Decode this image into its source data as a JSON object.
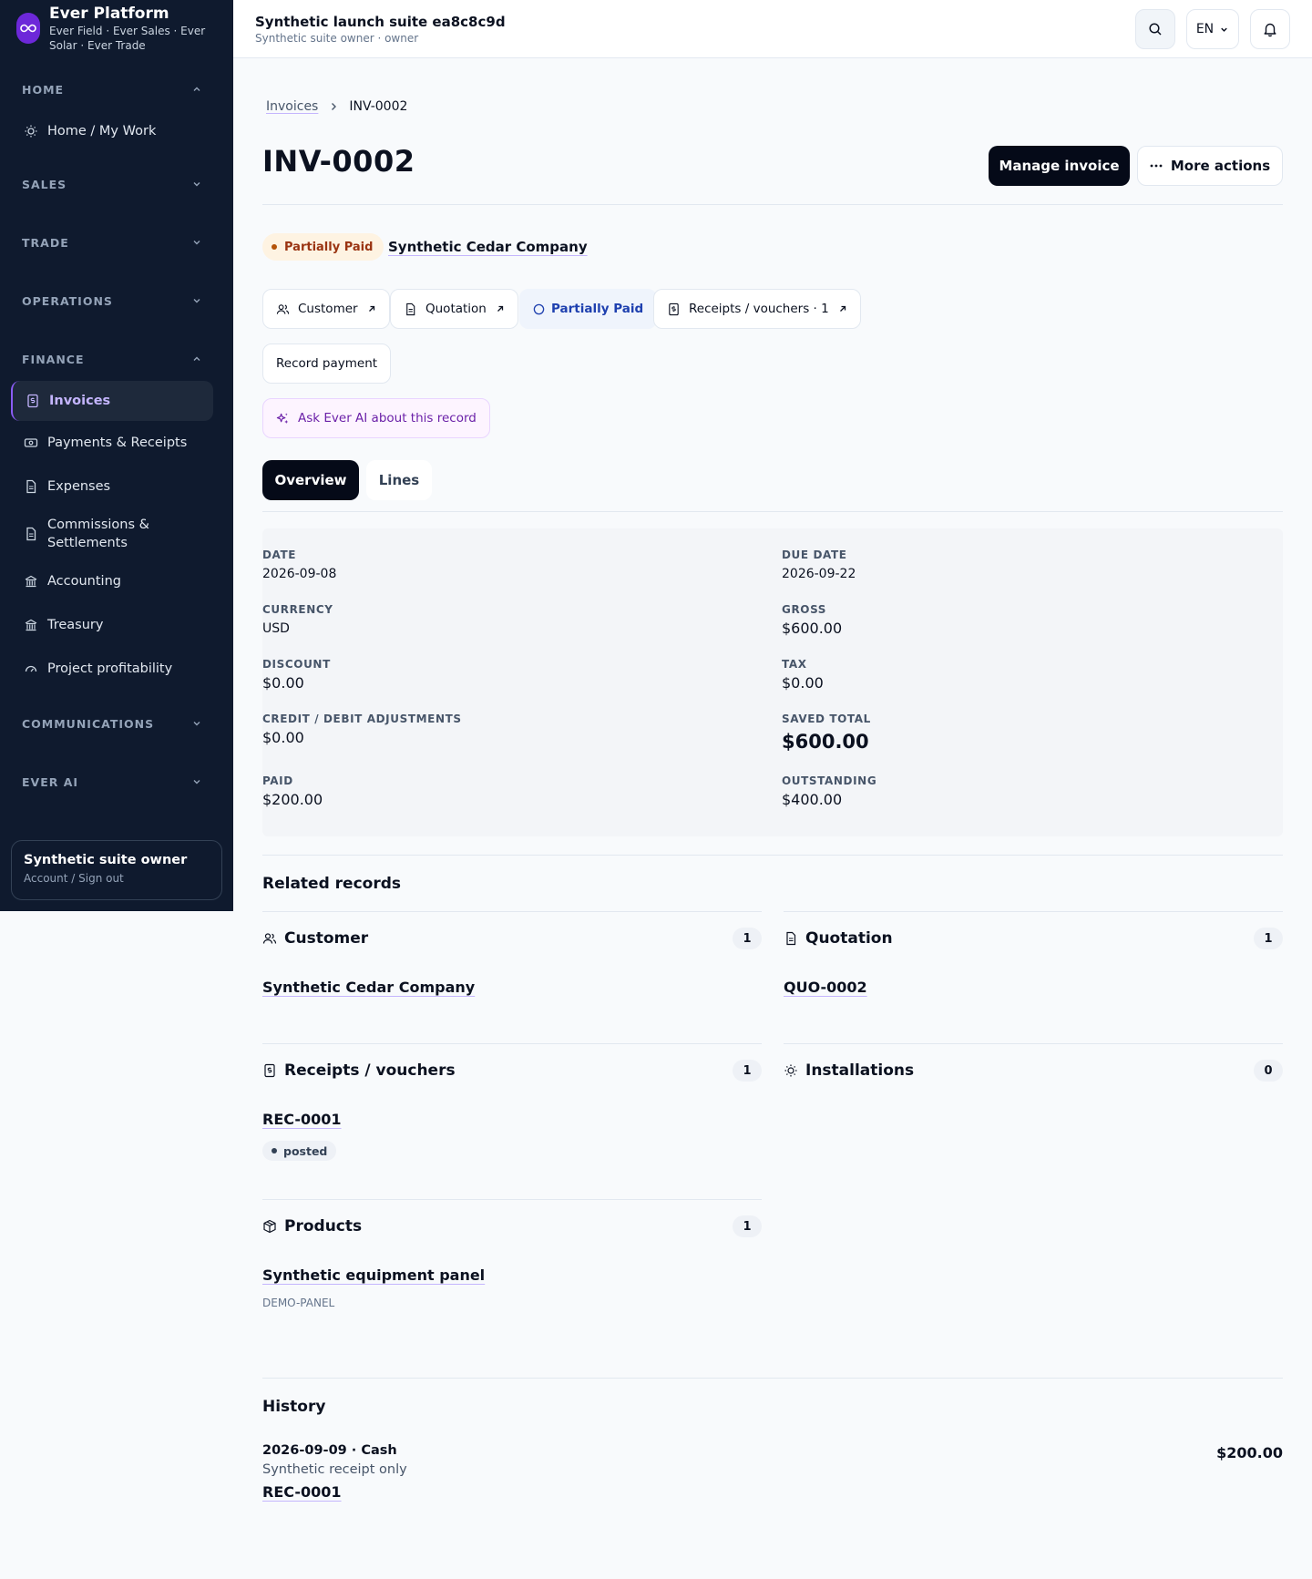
{
  "brand": {
    "name": "Ever Platform",
    "subtitle": "Ever Field · Ever Sales · Ever Solar · Ever Trade"
  },
  "sidebar": {
    "groups": {
      "home": "HOME",
      "sales": "SALES",
      "trade": "TRADE",
      "operations": "OPERATIONS",
      "finance": "FINANCE",
      "communications": "COMMUNICATIONS",
      "ever_ai": "EVER AI"
    },
    "home_item": "Home / My Work",
    "finance_items": [
      {
        "label": "Invoices",
        "icon": "receipt-icon"
      },
      {
        "label": "Payments & Receipts",
        "icon": "banknote-icon"
      },
      {
        "label": "Expenses",
        "icon": "document-icon"
      },
      {
        "label": "Commissions & Settlements",
        "icon": "document-icon"
      },
      {
        "label": "Accounting",
        "icon": "bank-icon"
      },
      {
        "label": "Treasury",
        "icon": "bank-icon"
      },
      {
        "label": "Project profitability",
        "icon": "gauge-icon"
      }
    ],
    "account": {
      "name": "Synthetic suite owner",
      "link": "Account / Sign out"
    }
  },
  "topbar": {
    "title": "Synthetic launch suite ea8c8c9d",
    "subtitle": "Synthetic suite owner · owner",
    "lang": "EN"
  },
  "breadcrumb": {
    "parent": "Invoices",
    "current": "INV-0002"
  },
  "page": {
    "title": "INV-0002",
    "primary_action": "Manage invoice",
    "secondary_action": "More actions"
  },
  "summary": {
    "status": "Partially Paid",
    "customer": "Synthetic Cedar Company"
  },
  "chips": {
    "customer": "Customer",
    "quotation": "Quotation",
    "status": "Partially Paid",
    "receipts": "Receipts / vouchers · 1",
    "record_payment": "Record payment",
    "ask_ai": "Ask Ever AI about this record"
  },
  "tabs": {
    "overview": "Overview",
    "lines": "Lines"
  },
  "overview": {
    "date": {
      "label": "DATE",
      "value": "2026-09-08"
    },
    "due_date": {
      "label": "DUE DATE",
      "value": "2026-09-22"
    },
    "currency": {
      "label": "CURRENCY",
      "value": "USD"
    },
    "gross": {
      "label": "GROSS",
      "value": "$600.00"
    },
    "discount": {
      "label": "DISCOUNT",
      "value": "$0.00"
    },
    "tax": {
      "label": "TAX",
      "value": "$0.00"
    },
    "adjustments": {
      "label": "CREDIT / DEBIT ADJUSTMENTS",
      "value": "$0.00"
    },
    "saved_total": {
      "label": "SAVED TOTAL",
      "value": "$600.00"
    },
    "paid": {
      "label": "PAID",
      "value": "$200.00"
    },
    "outstanding": {
      "label": "OUTSTANDING",
      "value": "$400.00"
    }
  },
  "related": {
    "title": "Related records",
    "customer": {
      "title": "Customer",
      "count": "1",
      "item": "Synthetic Cedar Company"
    },
    "quotation": {
      "title": "Quotation",
      "count": "1",
      "item": "QUO-0002"
    },
    "receipts": {
      "title": "Receipts / vouchers",
      "count": "1",
      "item": "REC-0001",
      "badge": "posted"
    },
    "installations": {
      "title": "Installations",
      "count": "0"
    },
    "products": {
      "title": "Products",
      "count": "1",
      "item": "Synthetic equipment panel",
      "sku": "DEMO-PANEL"
    }
  },
  "history": {
    "title": "History",
    "entry": {
      "date_method": "2026-09-09 · Cash",
      "note": "Synthetic receipt only",
      "link": "REC-0001",
      "amount": "$200.00"
    }
  }
}
